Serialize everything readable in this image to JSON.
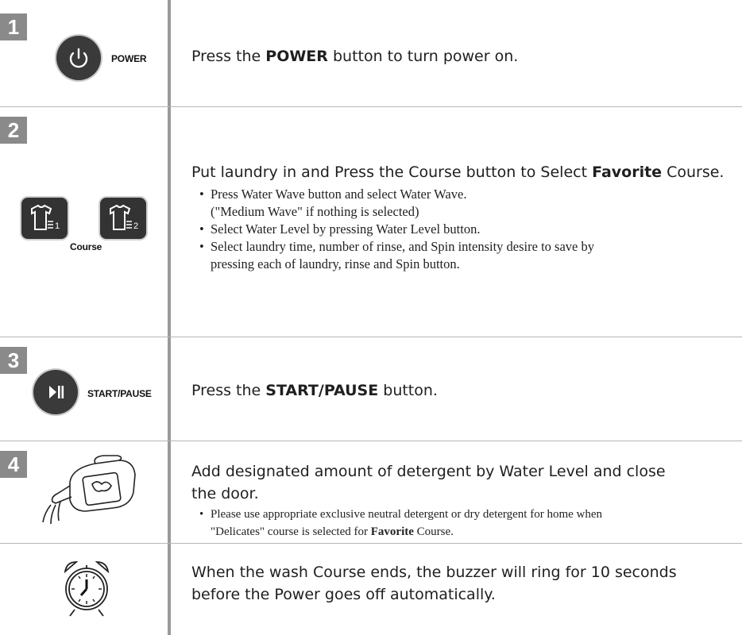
{
  "steps": [
    {
      "number": "1",
      "button_label": "POWER",
      "text_pre": "Press the ",
      "text_bold": "POWER",
      "text_post": " button to turn power on."
    },
    {
      "number": "2",
      "button_label": "Course",
      "button_sublabels": [
        "1",
        "2"
      ],
      "text_pre": "Put laundry in and Press the Course button to Select ",
      "text_bold": "Favorite",
      "text_post": " Course.",
      "bullets": [
        {
          "line1": "Press Water Wave button and select Water Wave.",
          "line2": "(\"Medium Wave\" if nothing is selected)"
        },
        {
          "line1": "Select Water Level by pressing Water Level button."
        },
        {
          "line1": "Select laundry time, number of rinse, and Spin intensity desire to save by",
          "line2": "pressing each of laundry, rinse and Spin button."
        }
      ]
    },
    {
      "number": "3",
      "button_label": "START/PAUSE",
      "text_pre": "Press the ",
      "text_bold": "START/PAUSE",
      "text_post": " button."
    },
    {
      "number": "4",
      "line1": "Add designated amount of detergent by Water Level and close",
      "line2": "the door.",
      "bullet_line1": "Please use appropriate exclusive neutral detergent or dry detergent for home when",
      "bullet_line2_pre": "\"Delicates\" course is selected for ",
      "bullet_line2_bold": "Favorite",
      "bullet_line2_post": " Course."
    },
    {
      "line1": "When the wash Course ends, the buzzer will ring for 10 seconds",
      "line2": "before the Power goes off automatically."
    }
  ],
  "icons": {
    "power": "power-icon",
    "course": "shirt-icon",
    "start_pause": "play-pause-icon",
    "detergent": "detergent-bottle-icon",
    "alarm": "alarm-clock-icon"
  },
  "colors": {
    "number_badge": "#8a8a8a",
    "button_dark": "#3a3a3a",
    "divider": "#b5b5b5"
  }
}
